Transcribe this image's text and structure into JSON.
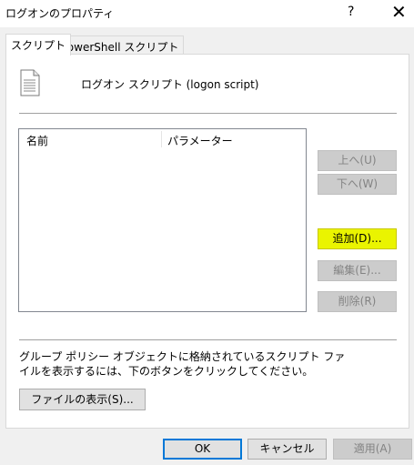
{
  "window": {
    "title": "ログオンのプロパティ",
    "help": "?",
    "close": "✕"
  },
  "tabs": [
    {
      "label": "スクリプト",
      "active": true
    },
    {
      "label": "PowerShell スクリプト",
      "active": false
    }
  ],
  "header": {
    "icon": "script-file-icon",
    "label": "ログオン スクリプト (logon script)"
  },
  "list": {
    "columns": [
      "名前",
      "パラメーター"
    ],
    "rows": []
  },
  "buttons": {
    "up": "上へ(U)",
    "down": "下へ(W)",
    "add": "追加(D)...",
    "edit": "編集(E)...",
    "delete": "削除(R)",
    "show_files": "ファイルの表示(S)...",
    "ok": "OK",
    "cancel": "キャンセル",
    "apply": "適用(A)"
  },
  "description": "グループ ポリシー オブジェクトに格納されているスクリプト ファイルを表示するには、下のボタンをクリックしてください。"
}
